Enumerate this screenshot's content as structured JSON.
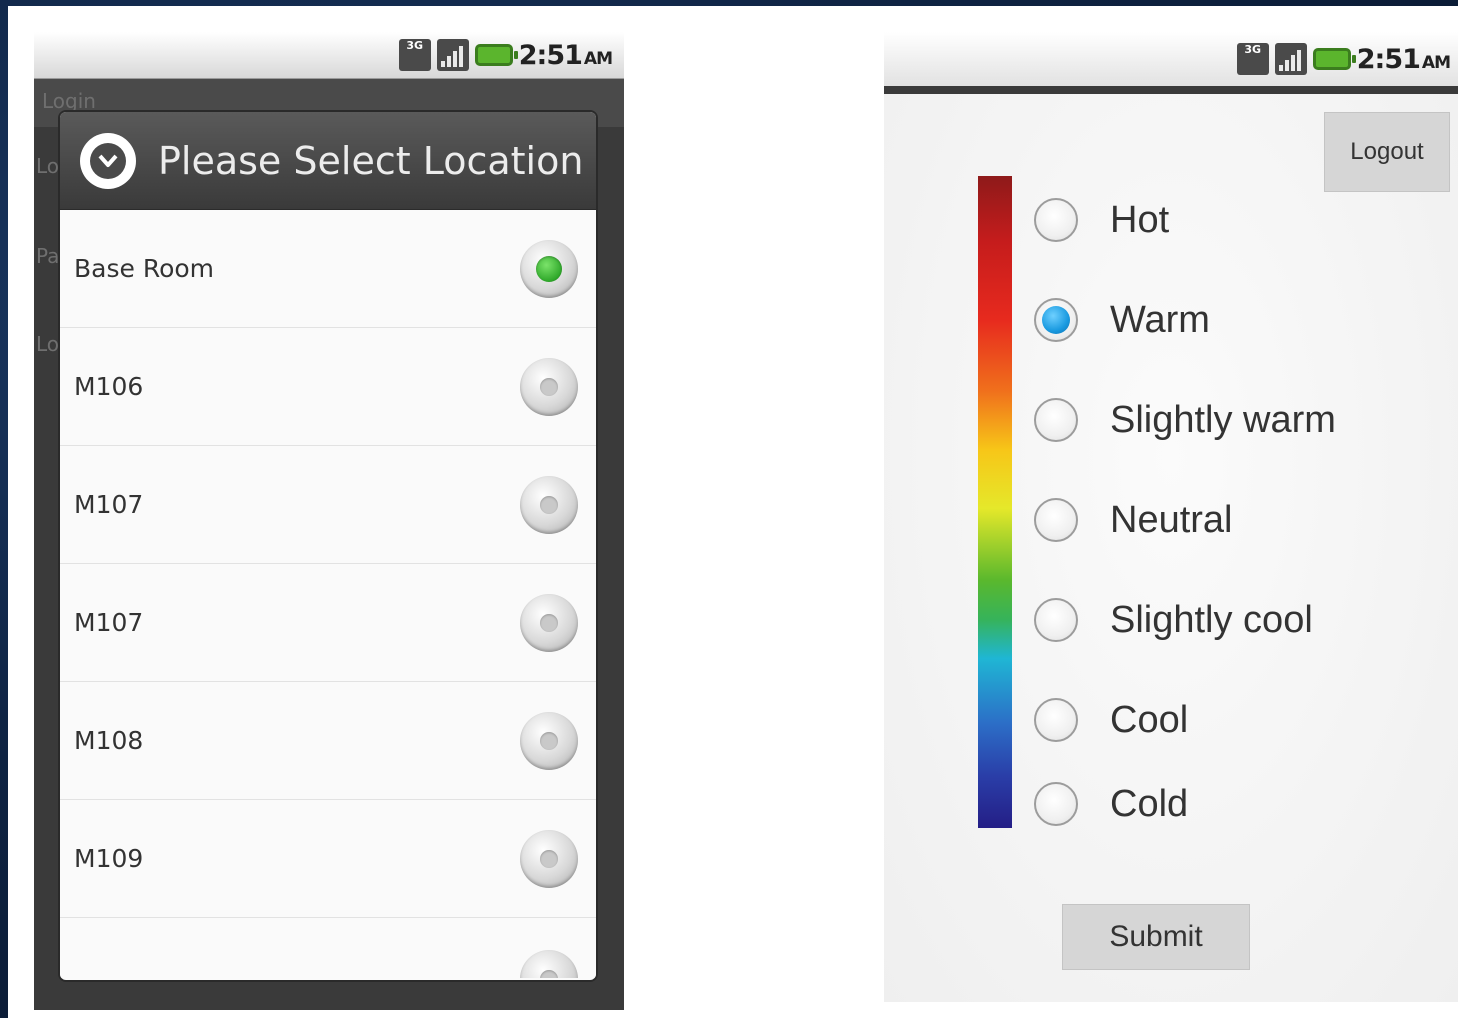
{
  "left_screen": {
    "status": {
      "time": "2:51",
      "ampm": "AM",
      "network_label": "3G"
    },
    "background_title": "Login",
    "background_hints": [
      "Lo",
      "Pa",
      "Lo"
    ],
    "dialog": {
      "title": "Please Select Location",
      "items": [
        {
          "label": "Base Room",
          "selected": true
        },
        {
          "label": "M106",
          "selected": false
        },
        {
          "label": "M107",
          "selected": false
        },
        {
          "label": "M107",
          "selected": false
        },
        {
          "label": "M108",
          "selected": false
        },
        {
          "label": "M109",
          "selected": false
        }
      ]
    }
  },
  "right_screen": {
    "status": {
      "time": "2:51",
      "ampm": "AM",
      "network_label": "3G"
    },
    "logout_label": "Logout",
    "comfort_options": [
      {
        "label": "Hot",
        "selected": false
      },
      {
        "label": "Warm",
        "selected": true
      },
      {
        "label": "Slightly warm",
        "selected": false
      },
      {
        "label": "Neutral",
        "selected": false
      },
      {
        "label": "Slightly cool",
        "selected": false
      },
      {
        "label": "Cool",
        "selected": false
      },
      {
        "label": "Cold",
        "selected": false
      }
    ],
    "submit_label": "Submit"
  },
  "colors": {
    "selected_location_radio": "#2fa82a",
    "selected_comfort_radio": "#1a9ae0",
    "dialog_header": "#3a3a3a",
    "scale_hot": "#8e1a1a",
    "scale_cold": "#241e86"
  }
}
